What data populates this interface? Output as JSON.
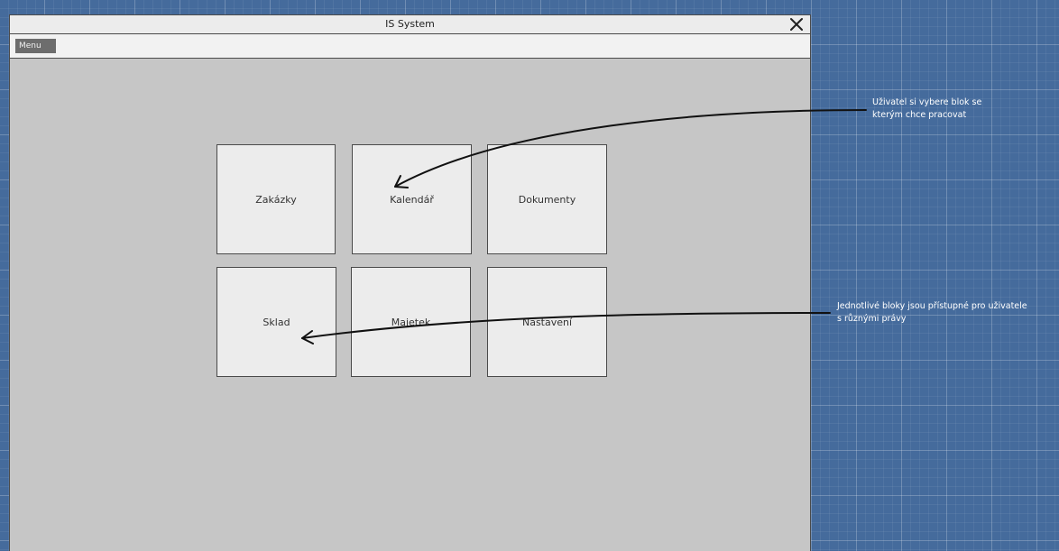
{
  "window": {
    "title": "IS System"
  },
  "menu": {
    "label": "Menu"
  },
  "tiles": [
    "Zakázky",
    "Kalendář",
    "Dokumenty",
    "Sklad",
    "Majetek",
    "Nastavení"
  ],
  "notes": [
    "Uživatel si vybere blok se\nkterým chce pracovat",
    "Jednotlivé bloky jsou přístupné pro uživatele\ns různými právy"
  ],
  "colors": {
    "canvas_bg": "#456b9c",
    "window_bg": "#c6c6c6",
    "tile_bg": "#ececec",
    "menu_button_bg": "#6d6d6d"
  },
  "icons": {
    "close": "close-icon"
  }
}
